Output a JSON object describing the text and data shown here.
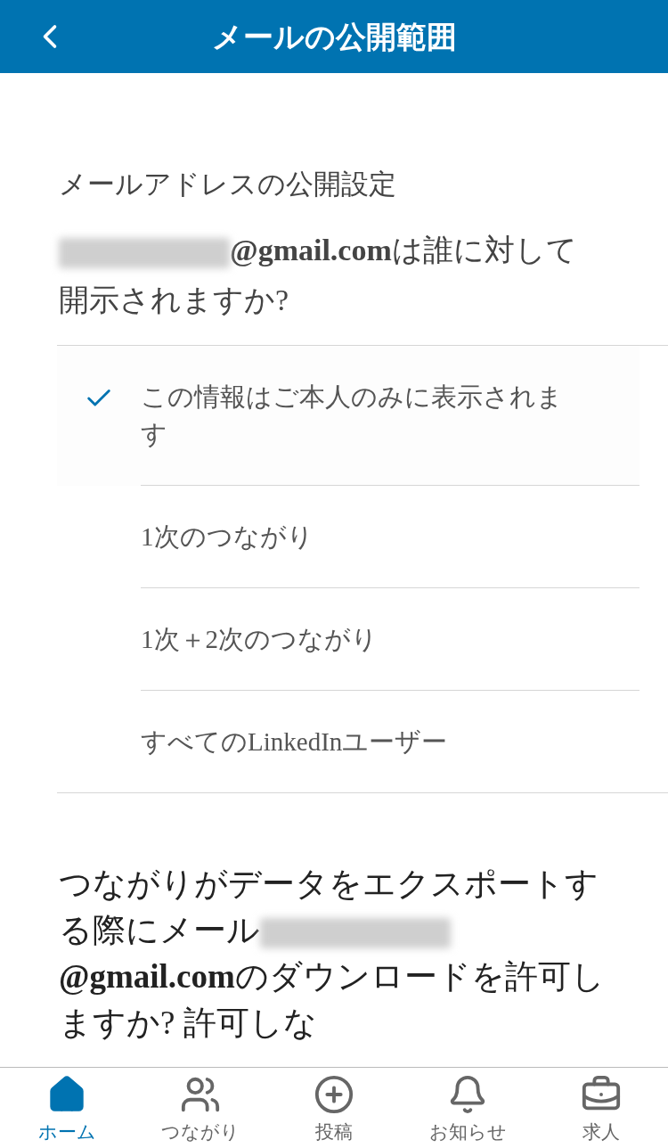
{
  "header": {
    "title": "メールの公開範囲"
  },
  "section_title": "メールアドレスの公開設定",
  "question": {
    "email_domain": "@gmail.com",
    "text": "は誰に対して開示されますか?"
  },
  "options": [
    {
      "label": "この情報はご本人のみに表示されます",
      "selected": true
    },
    {
      "label": "1次のつながり",
      "selected": false
    },
    {
      "label": "1次＋2次のつながり",
      "selected": false
    },
    {
      "label": "すべてのLinkedInユーザー",
      "selected": false
    }
  ],
  "export_question": {
    "before": "つながりがデータをエクスポートする際にメール",
    "email_domain": "@gmail.com",
    "after": "のダウンロードを許可しますか? 許可しな"
  },
  "nav": [
    {
      "kind": "home",
      "label": "ホーム",
      "selected": true
    },
    {
      "kind": "network",
      "label": "つながり",
      "selected": false
    },
    {
      "kind": "post",
      "label": "投稿",
      "selected": false
    },
    {
      "kind": "notifications",
      "label": "お知らせ",
      "selected": false
    },
    {
      "kind": "jobs",
      "label": "求人",
      "selected": false
    }
  ]
}
